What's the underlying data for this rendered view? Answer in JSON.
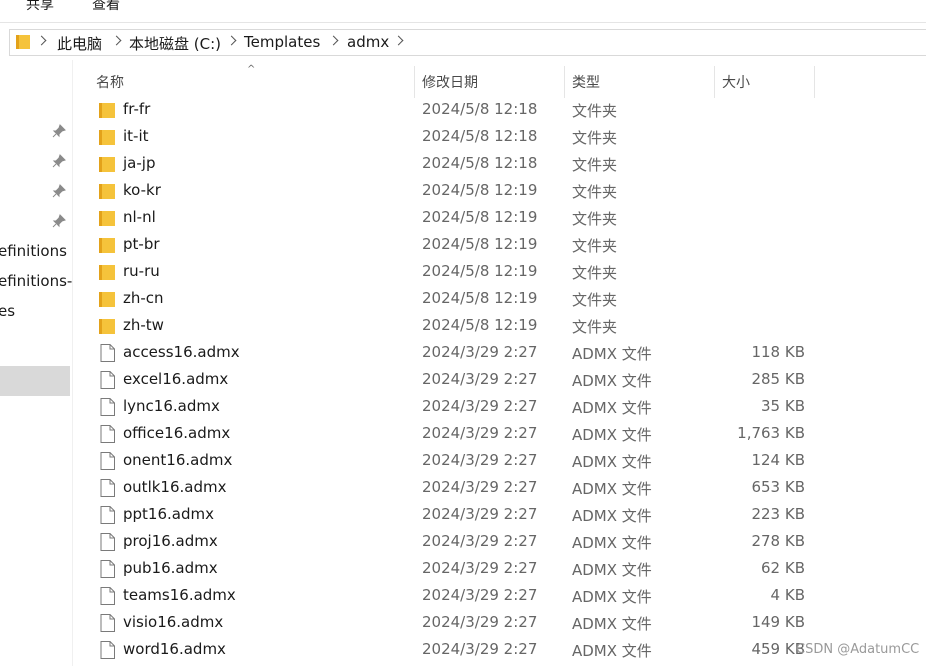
{
  "ribbon": {
    "tabs": [
      "共享",
      "查看"
    ]
  },
  "address": {
    "crumbs": [
      "此电脑",
      "本地磁盘 (C:)",
      "Templates",
      "admx"
    ]
  },
  "nav": {
    "items": [
      "efinitions",
      "efinitions-",
      "es"
    ]
  },
  "columns": {
    "name": "名称",
    "date": "修改日期",
    "type": "类型",
    "size": "大小"
  },
  "files": [
    {
      "name": "fr-fr",
      "date": "2024/5/8 12:18",
      "type": "文件夹",
      "size": "",
      "icon": "folder-icon"
    },
    {
      "name": "it-it",
      "date": "2024/5/8 12:18",
      "type": "文件夹",
      "size": "",
      "icon": "folder-icon"
    },
    {
      "name": "ja-jp",
      "date": "2024/5/8 12:18",
      "type": "文件夹",
      "size": "",
      "icon": "folder-icon"
    },
    {
      "name": "ko-kr",
      "date": "2024/5/8 12:19",
      "type": "文件夹",
      "size": "",
      "icon": "folder-icon"
    },
    {
      "name": "nl-nl",
      "date": "2024/5/8 12:19",
      "type": "文件夹",
      "size": "",
      "icon": "folder-icon"
    },
    {
      "name": "pt-br",
      "date": "2024/5/8 12:19",
      "type": "文件夹",
      "size": "",
      "icon": "folder-icon"
    },
    {
      "name": "ru-ru",
      "date": "2024/5/8 12:19",
      "type": "文件夹",
      "size": "",
      "icon": "folder-icon"
    },
    {
      "name": "zh-cn",
      "date": "2024/5/8 12:19",
      "type": "文件夹",
      "size": "",
      "icon": "folder-icon"
    },
    {
      "name": "zh-tw",
      "date": "2024/5/8 12:19",
      "type": "文件夹",
      "size": "",
      "icon": "folder-icon"
    },
    {
      "name": "access16.admx",
      "date": "2024/3/29 2:27",
      "type": "ADMX 文件",
      "size": "118 KB",
      "icon": "file-icon"
    },
    {
      "name": "excel16.admx",
      "date": "2024/3/29 2:27",
      "type": "ADMX 文件",
      "size": "285 KB",
      "icon": "file-icon"
    },
    {
      "name": "lync16.admx",
      "date": "2024/3/29 2:27",
      "type": "ADMX 文件",
      "size": "35 KB",
      "icon": "file-icon"
    },
    {
      "name": "office16.admx",
      "date": "2024/3/29 2:27",
      "type": "ADMX 文件",
      "size": "1,763 KB",
      "icon": "file-icon"
    },
    {
      "name": "onent16.admx",
      "date": "2024/3/29 2:27",
      "type": "ADMX 文件",
      "size": "124 KB",
      "icon": "file-icon"
    },
    {
      "name": "outlk16.admx",
      "date": "2024/3/29 2:27",
      "type": "ADMX 文件",
      "size": "653 KB",
      "icon": "file-icon"
    },
    {
      "name": "ppt16.admx",
      "date": "2024/3/29 2:27",
      "type": "ADMX 文件",
      "size": "223 KB",
      "icon": "file-icon"
    },
    {
      "name": "proj16.admx",
      "date": "2024/3/29 2:27",
      "type": "ADMX 文件",
      "size": "278 KB",
      "icon": "file-icon"
    },
    {
      "name": "pub16.admx",
      "date": "2024/3/29 2:27",
      "type": "ADMX 文件",
      "size": "62 KB",
      "icon": "file-icon"
    },
    {
      "name": "teams16.admx",
      "date": "2024/3/29 2:27",
      "type": "ADMX 文件",
      "size": "4 KB",
      "icon": "file-icon"
    },
    {
      "name": "visio16.admx",
      "date": "2024/3/29 2:27",
      "type": "ADMX 文件",
      "size": "149 KB",
      "icon": "file-icon"
    },
    {
      "name": "word16.admx",
      "date": "2024/3/29 2:27",
      "type": "ADMX 文件",
      "size": "459 KB",
      "icon": "file-icon"
    }
  ],
  "watermark": "CSDN @AdatumCC",
  "colors": {
    "folder": "#f5c33b",
    "folder_dark": "#e3a21a",
    "selection": "#d9d9d9"
  }
}
